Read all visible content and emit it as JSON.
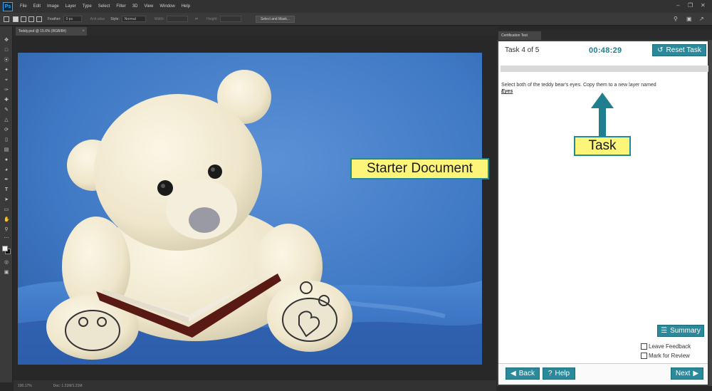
{
  "app": {
    "menu": [
      "File",
      "Edit",
      "Image",
      "Layer",
      "Type",
      "Select",
      "Filter",
      "3D",
      "View",
      "Window",
      "Help"
    ]
  },
  "options": {
    "feather_label": "Feather:",
    "feather_value": "0 px",
    "antialias_label": "Anti-alias",
    "style_label": "Style:",
    "style_value": "Normal",
    "width_label": "Width:",
    "height_label": "Height:",
    "select_mask_label": "Select and Mask..."
  },
  "document": {
    "tab_label": "Teddy.psd @ 15.6% (RGB/8#)"
  },
  "status": {
    "zoom": "100.17%",
    "doc_size": "Doc: 1.21M/1.21M"
  },
  "annotations": {
    "starter": "Starter Document",
    "task": "Task"
  },
  "panel": {
    "tab_label": "Certification Test",
    "task_count": "Task 4 of 5",
    "timer": "00:48:29",
    "reset_label": "Reset Task",
    "instruction": "Select both of the teddy bear's eyes. Copy them to a new layer named",
    "layer_name": "Eyes",
    "summary_label": "Summary",
    "leave_feedback": "Leave Feedback",
    "mark_review": "Mark for Review",
    "back_label": "Back",
    "help_label": "Help",
    "next_label": "Next"
  },
  "colors": {
    "accent_teal": "#2a8a9c",
    "timer": "#1d7f8f",
    "annotation_yellow": "#fdf47a",
    "photo_blue": "#3f78c4"
  }
}
